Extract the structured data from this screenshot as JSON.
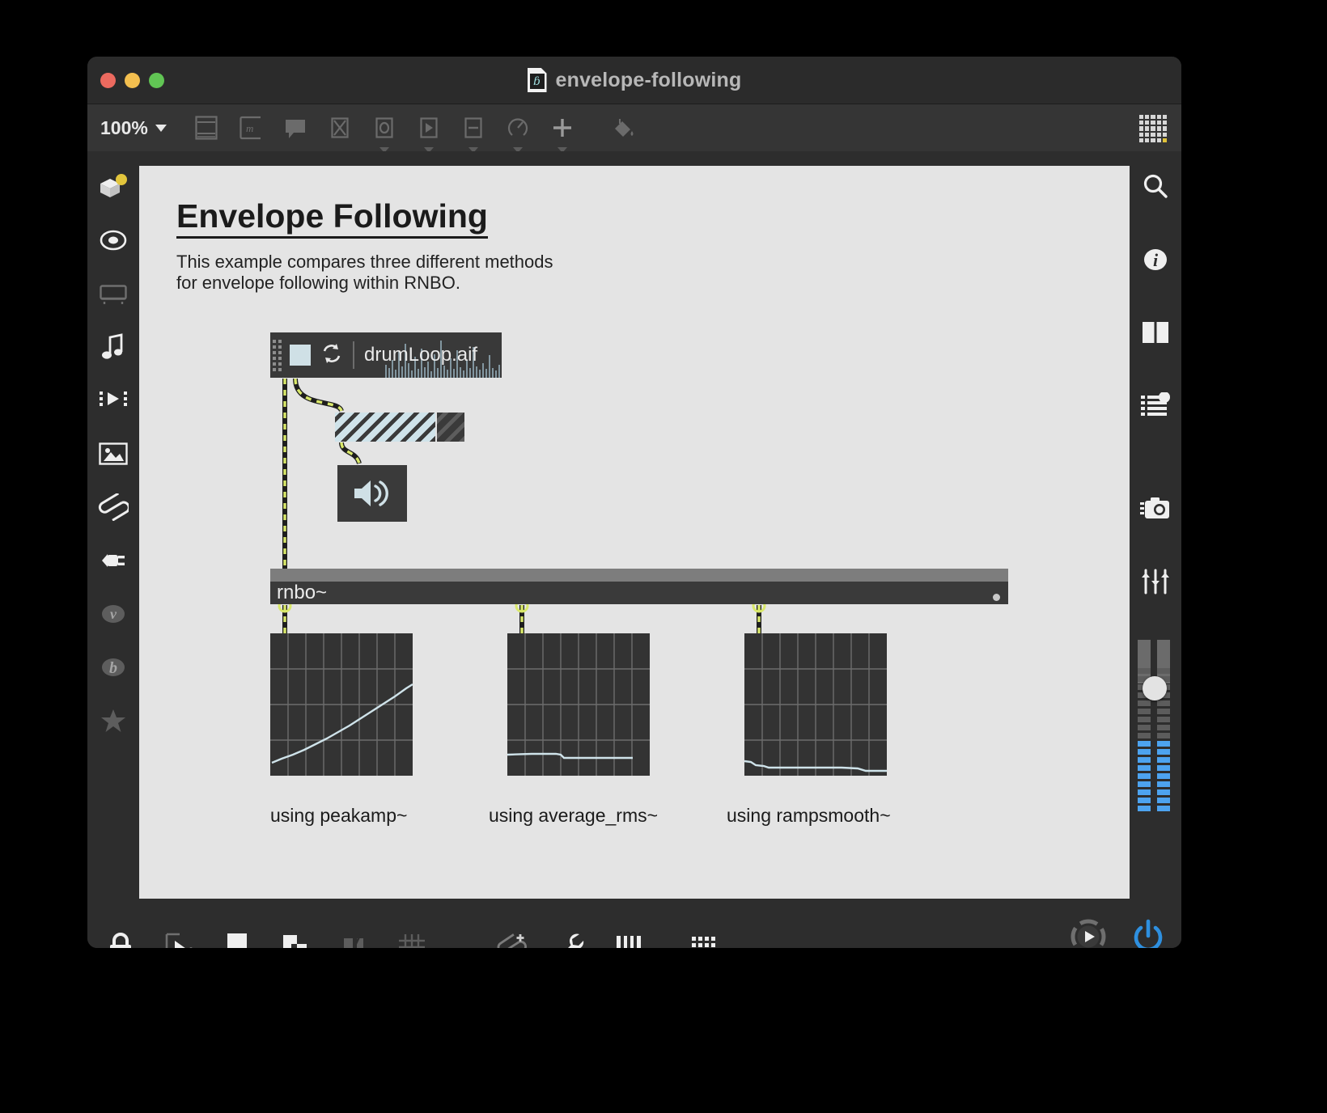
{
  "window": {
    "title": "envelope-following",
    "doc_icon_glyph": "ɓ",
    "traffic_lights": [
      "close",
      "minimize",
      "maximize"
    ]
  },
  "toolbar": {
    "zoom_level": "100%",
    "items": [
      {
        "name": "object-palette-icon",
        "has_submenu": false
      },
      {
        "name": "message-box-icon",
        "has_submenu": false
      },
      {
        "name": "comment-icon",
        "has_submenu": false
      },
      {
        "name": "toggle-icon",
        "has_submenu": false
      },
      {
        "name": "button-icon",
        "has_submenu": true
      },
      {
        "name": "playbar-icon",
        "has_submenu": true
      },
      {
        "name": "slider-icon",
        "has_submenu": true
      },
      {
        "name": "dial-icon",
        "has_submenu": true
      },
      {
        "name": "add-object-icon",
        "has_submenu": true
      },
      {
        "name": "paint-bucket-icon",
        "has_submenu": false
      }
    ],
    "grid_button": "snippet-grid-icon"
  },
  "left_rail": [
    {
      "name": "sidebar-packages",
      "icon": "package-box-icon",
      "badge": "#e2c53c"
    },
    {
      "name": "sidebar-snapshots",
      "icon": "target-ellipse-icon"
    },
    {
      "name": "sidebar-devices",
      "icon": "keyboard-device-icon"
    },
    {
      "name": "sidebar-audio",
      "icon": "music-note-icon"
    },
    {
      "name": "sidebar-video",
      "icon": "film-play-icon"
    },
    {
      "name": "sidebar-images",
      "icon": "picture-icon"
    },
    {
      "name": "sidebar-clippings",
      "icon": "paperclip-icon"
    },
    {
      "name": "sidebar-plugins",
      "icon": "plug-icon"
    },
    {
      "name": "sidebar-vizzie",
      "icon": "vizzie-v-icon"
    },
    {
      "name": "sidebar-beap",
      "icon": "beap-b-icon"
    },
    {
      "name": "sidebar-favorites",
      "icon": "star-icon"
    }
  ],
  "right_rail": [
    {
      "name": "search-button",
      "icon": "search-icon"
    },
    {
      "name": "reference-button",
      "icon": "info-icon"
    },
    {
      "name": "columns-button",
      "icon": "two-columns-icon"
    },
    {
      "name": "parameters-button",
      "icon": "list-dot-icon"
    },
    {
      "name": "snapshot-button",
      "icon": "camera-icon"
    },
    {
      "name": "mixer-button",
      "icon": "sliders-icon"
    }
  ],
  "meter": {
    "name": "master-level-meter",
    "channels": 2,
    "segments_total": 22,
    "segments_lit": 9,
    "lit_color": "#4da3ef",
    "unlit_color": "#5c5c5c",
    "knob_color": "#e3e3e3"
  },
  "bottom_bar": {
    "left_items": [
      {
        "name": "lock-patcher-button",
        "icon": "lock-icon"
      },
      {
        "name": "edit-mode-button",
        "icon": "cursor-select-icon"
      },
      {
        "name": "presentation-mode-button",
        "icon": "presentation-pin-icon"
      },
      {
        "name": "arrange-button",
        "icon": "overlapping-squares-icon"
      },
      {
        "name": "snap-to-object-button",
        "icon": "snap-flag-icon"
      },
      {
        "name": "grid-button",
        "icon": "grid-hash-icon"
      },
      {
        "name": "add-clipping-button",
        "icon": "paperclip-plus-icon"
      },
      {
        "name": "inspector-button",
        "icon": "wrench-icon"
      },
      {
        "name": "keyboard-mapping-button",
        "icon": "piano-keys-icon"
      },
      {
        "name": "computer-keyboard-button",
        "icon": "keyboard-icon"
      }
    ],
    "right_items": [
      {
        "name": "transport-button",
        "icon": "transport-play-icon"
      },
      {
        "name": "audio-power-button",
        "icon": "power-icon",
        "color": "#2e90e0"
      }
    ]
  },
  "patch": {
    "title": "Envelope Following",
    "description": "This example compares three different methods for envelope following within RNBO.",
    "playlist_object": {
      "name": "playlist-object",
      "filename": "drumLoop.aif",
      "stop_button": "stop-square",
      "loop_button": "loop-icon"
    },
    "gain_slider": {
      "name": "gain-slider",
      "value_percent": 78
    },
    "dac_object": {
      "name": "ezdac-object",
      "icon": "speaker-icon"
    },
    "rnbo_object": {
      "name": "rnbo-object",
      "label": "rnbo~"
    },
    "scopes": [
      {
        "name": "scope-peakamp",
        "label": "using peakamp~",
        "trace": "rising-ramp"
      },
      {
        "name": "scope-average-rms",
        "label": "using average_rms~",
        "trace": "flat-low-step"
      },
      {
        "name": "scope-rampsmooth",
        "label": "using rampsmooth~",
        "trace": "flat-low-descending"
      }
    ],
    "trace_color": "#cfe3ea",
    "cord_color": "#d9e86a",
    "scope_bg": "#333333",
    "canvas_bg": "#e4e4e4"
  }
}
